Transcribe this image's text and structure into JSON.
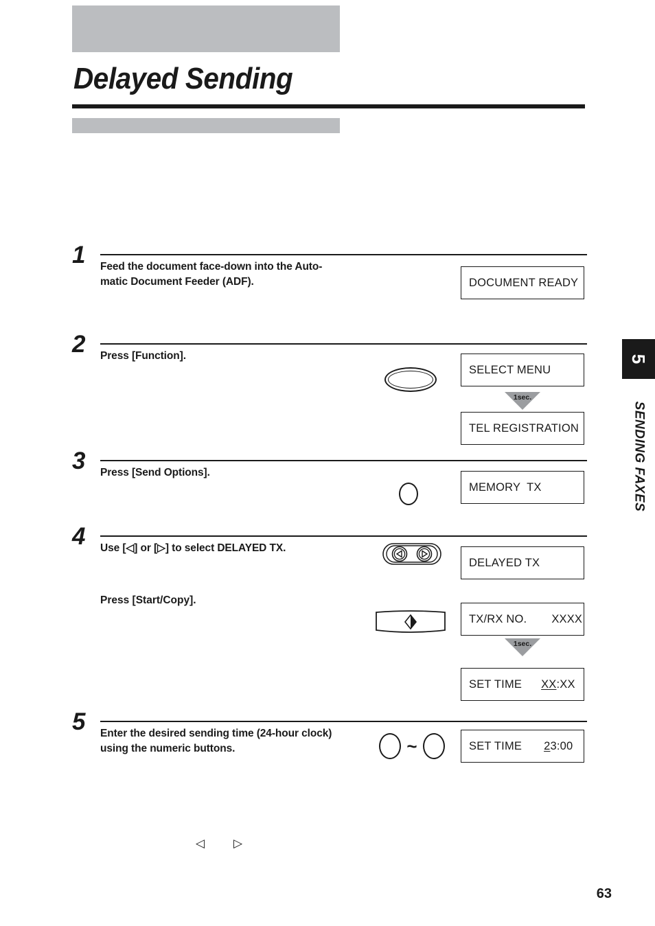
{
  "page": {
    "title": "Delayed Sending",
    "folio": "63"
  },
  "side_tab": {
    "chapter_number": "5",
    "chapter_label": "SENDING FAXES"
  },
  "steps": [
    {
      "number": "1",
      "text_line1": "Feed the document face-down into the Auto-",
      "text_line2": "matic Document Feeder (ADF)."
    },
    {
      "number": "2",
      "text_line1": "Press [Function].",
      "text_line2": ""
    },
    {
      "number": "3",
      "text_line1": "Press [Send Options].",
      "text_line2": ""
    },
    {
      "number": "4",
      "text_line1": "Use [◁] or [▷] to select DELAYED TX.",
      "text_line2": "",
      "substep_text": "Press [Start/Copy]."
    },
    {
      "number": "5",
      "text_line1": "Enter the desired sending time (24-hour clock)",
      "text_line2": "using the numeric buttons."
    }
  ],
  "lcd_displays": [
    {
      "id": "document-ready",
      "text": "DOCUMENT READY"
    },
    {
      "id": "select-menu",
      "text": "SELECT MENU"
    },
    {
      "id": "tel-registration",
      "text": "TEL REGISTRATION"
    },
    {
      "id": "memory-tx",
      "text": "MEMORY  TX"
    },
    {
      "id": "delayed-tx",
      "text": "DELAYED TX"
    },
    {
      "id": "tx-rx-no",
      "label": "TX/RX NO.",
      "value": "XXXX"
    },
    {
      "id": "set-time-blank",
      "label": "SET TIME",
      "value_underlined": "XX",
      "value_rest": ":XX"
    },
    {
      "id": "set-time-filled",
      "label": "SET TIME",
      "value_underlined": "2",
      "value_rest": "3:00"
    }
  ],
  "timing_arrows": [
    {
      "id": "timing-arrow-1",
      "label": "1sec."
    },
    {
      "id": "timing-arrow-2",
      "label": "1sec."
    }
  ],
  "stray_glyphs": {
    "left_arrow": "◁",
    "right_arrow": "▷"
  },
  "colors": {
    "gray_bar": "#bbbdc0",
    "ink": "#1a1a1a",
    "arrow_gray": "#9b9da0"
  }
}
